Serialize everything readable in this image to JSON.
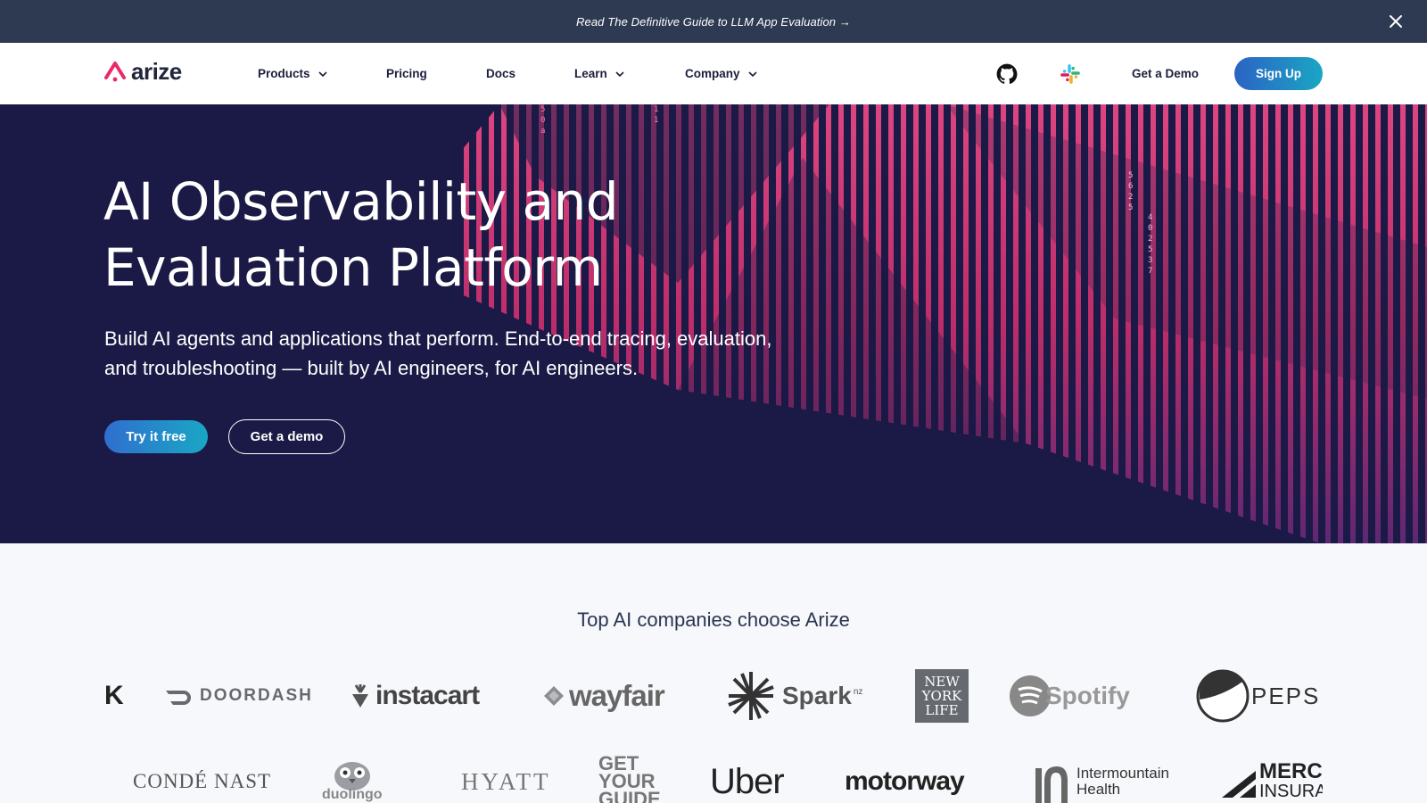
{
  "announcement": {
    "text": "Read The Definitive Guide to LLM App Evaluation →",
    "close_icon": "close-icon"
  },
  "nav": {
    "logo_text": "arize",
    "items": [
      {
        "label": "Products",
        "has_dropdown": true
      },
      {
        "label": "Pricing",
        "has_dropdown": false
      },
      {
        "label": "Docs",
        "has_dropdown": false
      },
      {
        "label": "Learn",
        "has_dropdown": true
      },
      {
        "label": "Company",
        "has_dropdown": true
      }
    ],
    "icons": [
      "github-icon",
      "slack-icon"
    ],
    "get_demo": "Get a Demo",
    "sign_up": "Sign Up"
  },
  "hero": {
    "title_line1": "AI Observability and",
    "title_line2": "Evaluation Platform",
    "subtitle_line1": "Build AI agents and applications that perform. End-to-end tracing, evaluation,",
    "subtitle_line2": "and troubleshooting — built by AI engineers, for AI engineers.",
    "primary_cta": "Try it free",
    "secondary_cta": "Get a demo",
    "digit_columns": [
      {
        "digits": "5 0 a"
      },
      {
        "digits": "1 1"
      },
      {
        "digits": "5 6 2 5"
      },
      {
        "digits": "4 0 2 5 3 7"
      }
    ]
  },
  "logos": {
    "heading": "Top AI companies choose Arize",
    "row1": [
      "K",
      "DOORDASH",
      "instacart",
      "wayfair",
      "Spark",
      "nz",
      "NEW",
      "YORK",
      "LIFE",
      "Spotify",
      "PEPS"
    ],
    "row2": [
      "CONDÉ NAST",
      "duolingo",
      "HYATT",
      "GET",
      "YOUR",
      "GUIDE",
      "Uber",
      "motorway",
      "Intermountain",
      "Health",
      "MERC",
      "INSURA"
    ]
  },
  "colors": {
    "announcement_bg": "#2e3a52",
    "hero_bg": "#1b1a46",
    "accent_pink": "#ff3d7f",
    "cta_gradient_start": "#2f6fcf",
    "cta_gradient_end": "#1aa6c4"
  }
}
